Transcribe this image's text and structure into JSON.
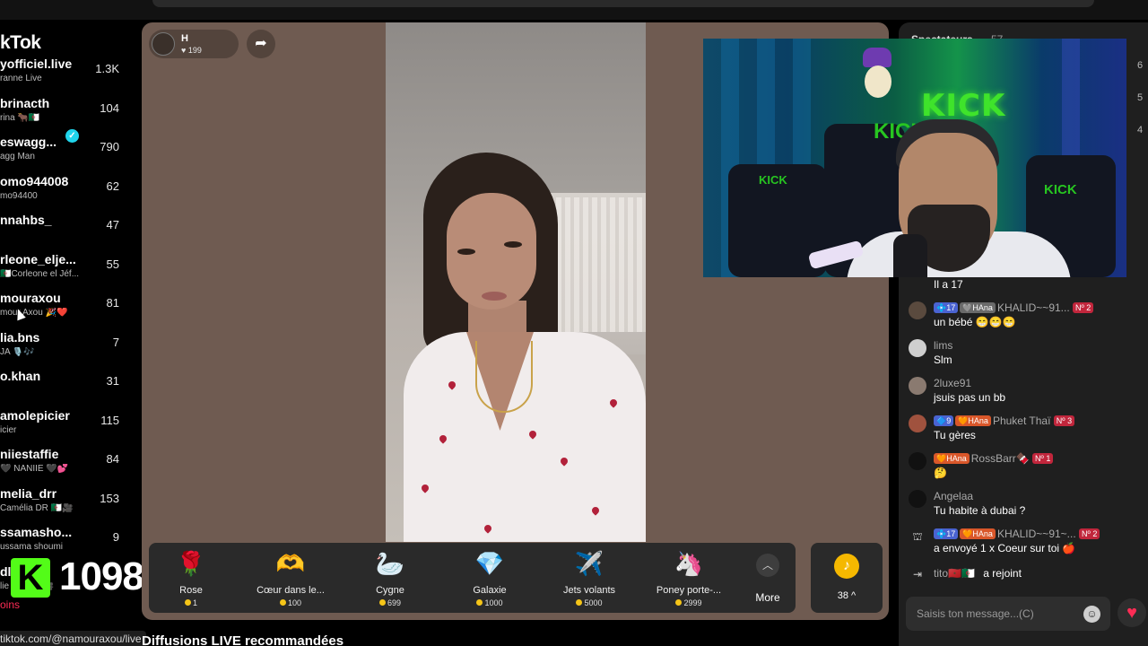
{
  "sidebar": {
    "logo": "kTok",
    "accounts": [
      {
        "name": "yofficiel.live",
        "sub": "ranne Live",
        "count": "1.3K"
      },
      {
        "name": "brinacth",
        "sub": "rina 🐂🇩🇿",
        "count": "104"
      },
      {
        "name": "eswagg...",
        "sub": "agg Man",
        "count": "790"
      },
      {
        "name": "omo944008",
        "sub": "mo94400",
        "count": "62"
      },
      {
        "name": "nnahbs_",
        "sub": "",
        "count": "47"
      },
      {
        "name": "rleone_elje...",
        "sub": "🇩🇿Corleone el Jéf...",
        "count": "55"
      },
      {
        "name": "mouraxou",
        "sub": "mour Axou 🎉❤️",
        "count": "81"
      },
      {
        "name": "lia.bns",
        "sub": "JA 🎙️🎶",
        "count": "7"
      },
      {
        "name": "o.khan",
        "sub": "",
        "count": "31"
      },
      {
        "name": "amolepicier",
        "sub": "icier",
        "count": "115"
      },
      {
        "name": "niiestaffie",
        "sub": "🖤 NANIIE 🖤💕",
        "count": "84"
      },
      {
        "name": "melia_drr",
        "sub": "Camélia DR 🇩🇿🎥",
        "count": "153"
      },
      {
        "name": "ssamasho...",
        "sub": "ussama shoumi",
        "count": "9"
      },
      {
        "name": "dli",
        "sub": "lie Rick 🖤🎥",
        "count": ""
      }
    ],
    "kick_count": "1098",
    "kick_letter": "K",
    "coins_link": "oins",
    "url": "tiktok.com/@namouraxou/live"
  },
  "stage": {
    "host_name": "H",
    "host_likes": "♥ 199",
    "share_icon": "share-arrow-icon"
  },
  "gifts": [
    {
      "name": "Rose",
      "price": "1",
      "icon": "🌹"
    },
    {
      "name": "Cœur dans le...",
      "price": "100",
      "icon": "🫶"
    },
    {
      "name": "Cygne",
      "price": "699",
      "icon": "🦢"
    },
    {
      "name": "Galaxie",
      "price": "1000",
      "icon": "💎"
    },
    {
      "name": "Jets volants",
      "price": "5000",
      "icon": "✈️"
    },
    {
      "name": "Poney porte-...",
      "price": "2999",
      "icon": "🦄"
    }
  ],
  "more_label": "More",
  "coins_count": "38 ^",
  "section_title": "Diffusions LIVE recommandées",
  "webcam": {
    "brand": "KICK"
  },
  "chat": {
    "spectators_label": "Spectateurs",
    "spectators_count": "57",
    "right_numbers": [
      "6",
      "5",
      "4"
    ],
    "partial_message": "Il a 17",
    "messages": [
      {
        "badges": [
          "💠17",
          "🩶HAna"
        ],
        "user": "KHALID~~91...",
        "rank": "Nº 2",
        "text": "un bébé 😁😁😁",
        "avatar_color": "#5a4a3e"
      },
      {
        "badges": [],
        "user": "lims",
        "rank": "",
        "text": "Slm",
        "avatar_color": "#cfcfcf"
      },
      {
        "badges": [],
        "user": "2luxe91",
        "rank": "",
        "text": "jsuis pas un bb",
        "avatar_color": "#8a7a70"
      },
      {
        "badges": [
          "🔷9",
          "🧡HAna"
        ],
        "user": "Phuket Thaï",
        "rank": "Nº 3",
        "text": "Tu gères",
        "avatar_color": "#a0523e"
      },
      {
        "badges": [
          "🧡HAna"
        ],
        "user": "RossBarr🍫",
        "rank": "Nº 1",
        "text": "🤔",
        "avatar_color": "#111111"
      },
      {
        "badges": [],
        "user": "Angelaa",
        "rank": "",
        "text": "Tu habite à dubai ?",
        "avatar_color": "#111111"
      },
      {
        "badges": [
          "💠17",
          "🧡HAna"
        ],
        "user": "KHALID~~91~...",
        "rank": "Nº 2",
        "text": "a envoyé 1 x Coeur sur toi 🍎",
        "avatar_color": ""
      },
      {
        "badges": [],
        "user": "tito🇲🇦🇩🇿",
        "rank": "",
        "text": "a rejoint",
        "avatar_color": ""
      }
    ],
    "input_placeholder": "Saisis ton message...(C)"
  }
}
